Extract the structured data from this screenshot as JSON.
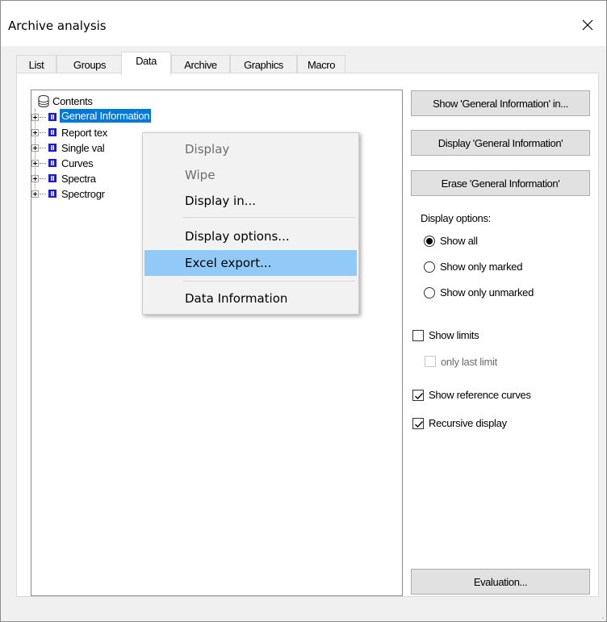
{
  "window": {
    "title": "Archive analysis",
    "close_icon": "close-icon"
  },
  "tabs": [
    {
      "label": "List",
      "active": false
    },
    {
      "label": "Groups",
      "active": false
    },
    {
      "label": "Data",
      "active": true
    },
    {
      "label": "Archive",
      "active": false
    },
    {
      "label": "Graphics",
      "active": false
    },
    {
      "label": "Macro",
      "active": false
    }
  ],
  "tree": {
    "root": {
      "label": "Contents",
      "icon": "database-icon"
    },
    "nodes": [
      {
        "label": "General Information",
        "selected": true,
        "icon": "data-node-icon"
      },
      {
        "label": "Report tex",
        "selected": false,
        "icon": "data-node-icon"
      },
      {
        "label": "Single val",
        "selected": false,
        "icon": "data-node-icon"
      },
      {
        "label": "Curves",
        "selected": false,
        "icon": "data-node-icon"
      },
      {
        "label": "Spectra",
        "selected": false,
        "icon": "data-node-icon"
      },
      {
        "label": "Spectrogr",
        "selected": false,
        "icon": "data-node-icon"
      }
    ],
    "colors": {
      "node_icon": "#1a1ad6",
      "selection": "#0078d7"
    }
  },
  "context_menu": {
    "items": [
      {
        "label": "Display",
        "disabled": true
      },
      {
        "label": "Wipe",
        "disabled": true
      },
      {
        "label": "Display in...",
        "disabled": false
      },
      {
        "label": "Display options...",
        "disabled": false
      },
      {
        "label": "Excel export...",
        "disabled": false,
        "highlighted": true
      },
      {
        "label": "Data Information",
        "disabled": false
      }
    ],
    "highlight_color": "#91c9f7"
  },
  "right_panel": {
    "show_in_button": "Show 'General Information' in...",
    "display_button": "Display 'General Information'",
    "erase_button": "Erase 'General Information'",
    "display_options_label": "Display options:",
    "radios": [
      {
        "label": "Show all",
        "checked": true
      },
      {
        "label": "Show only marked",
        "checked": false
      },
      {
        "label": "Show only unmarked",
        "checked": false
      }
    ],
    "show_limits": {
      "label": "Show limits",
      "checked": false
    },
    "only_last_limit": {
      "label": "only last limit",
      "checked": false,
      "disabled": true
    },
    "show_reference_curves": {
      "label": "Show reference curves",
      "checked": true
    },
    "recursive_display": {
      "label": "Recursive display",
      "checked": true
    },
    "evaluation_button": "Evaluation..."
  }
}
